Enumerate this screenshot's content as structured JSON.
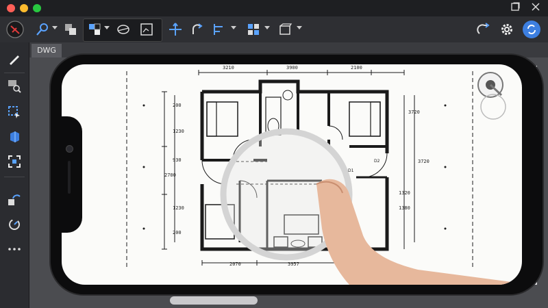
{
  "app": {
    "tab_label": "DWG"
  },
  "plan": {
    "dims_top": [
      "3210",
      "3900",
      "2100"
    ],
    "dims_bottom": [
      "2070",
      "3957"
    ],
    "dims_left": [
      "200",
      "1230",
      "930",
      "2700",
      "1230",
      "200"
    ],
    "dims_right": [
      "3720",
      "3720",
      "1320",
      "1380"
    ],
    "labels": [
      "D1",
      "D2"
    ]
  },
  "colors": {
    "accent": "#3d7fe0",
    "titlebar": "#1e1f22",
    "toolbar": "#2e2f33",
    "paper": "#fbfbf9",
    "ink": "#1a1a1a"
  },
  "icons": [
    "close-window-icon",
    "minimize-window-icon",
    "maximize-window-icon",
    "restore-window-icon",
    "app-close-icon",
    "app-logo-icon",
    "pen-tool-icon",
    "layers-icon",
    "layer-swap-icon",
    "layer-off-icon",
    "isolate-icon",
    "move-icon",
    "rotate-icon",
    "align-icon",
    "grid-icon",
    "block-icon",
    "sync-icon",
    "settings-icon",
    "user-icon",
    "draw-icon",
    "zoom-window-icon",
    "select-icon",
    "3d-box-icon",
    "fit-icon",
    "pan-icon",
    "measure-icon",
    "more-icon",
    "compass-icon"
  ]
}
